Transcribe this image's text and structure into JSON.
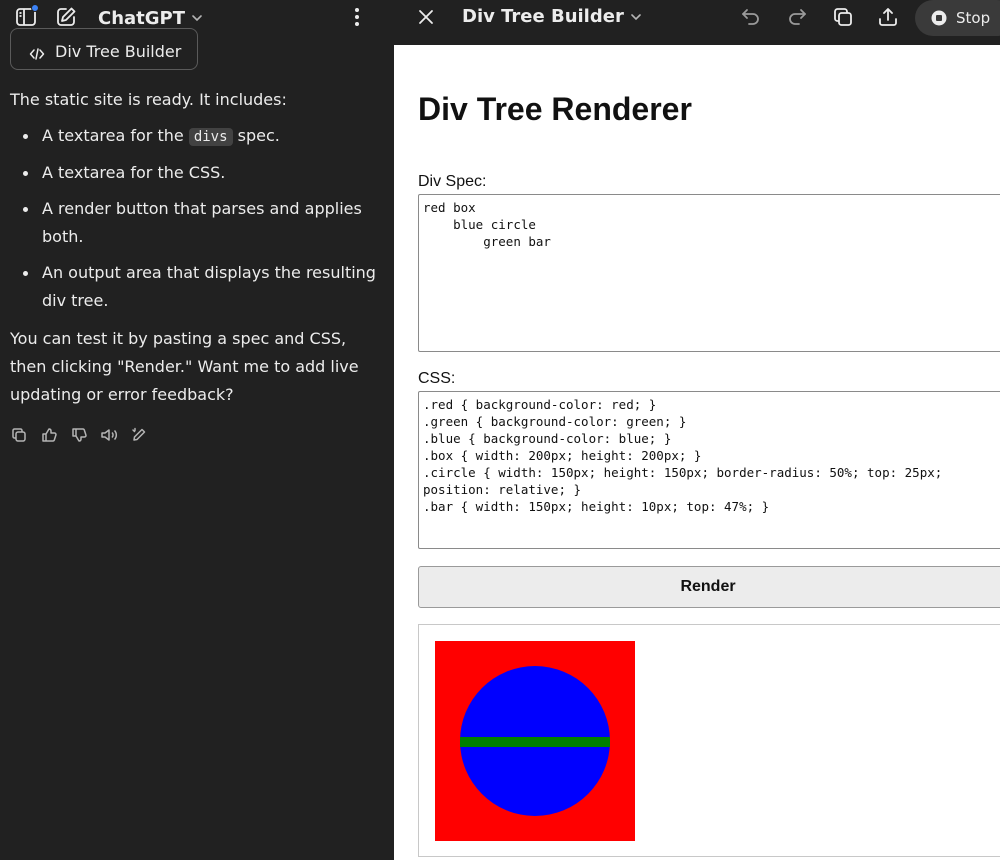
{
  "left_pane": {
    "model_name": "ChatGPT",
    "canvas_chip": {
      "label": "Div Tree Builder"
    },
    "message": {
      "intro": "The static site is ready. It includes:",
      "bullets": [
        {
          "before": "A textarea for the ",
          "code": "divs",
          "after": " spec."
        },
        {
          "before": "A textarea for the CSS.",
          "code": "",
          "after": ""
        },
        {
          "before": "A render button that parses and applies both.",
          "code": "",
          "after": ""
        },
        {
          "before": "An output area that displays the resulting div tree.",
          "code": "",
          "after": ""
        }
      ],
      "outro": "You can test it by pasting a spec and CSS, then clicking \"Render.\" Want me to add live updating or error feedback?"
    },
    "actions": [
      "copy-icon",
      "thumbs-up-icon",
      "thumbs-down-icon",
      "read-aloud-icon",
      "edit-icon"
    ]
  },
  "right_pane": {
    "doc_title": "Div Tree Builder",
    "stop_label": "Stop",
    "page": {
      "heading": "Div Tree Renderer",
      "spec_label": "Div Spec:",
      "spec_value": "red box\n    blue circle\n        green bar",
      "css_label": "CSS:",
      "css_value": ".red { background-color: red; }\n.green { background-color: green; }\n.blue { background-color: blue; }\n.box { width: 200px; height: 200px; }\n.circle { width: 150px; height: 150px; border-radius: 50%; top: 25px; position: relative; }\n.bar { width: 150px; height: 10px; top: 47%; }",
      "render_label": "Render"
    }
  },
  "colors": {
    "chat_bg": "#212121",
    "chat_text": "#ececec",
    "accent_dot": "#3b82f6",
    "render_red": "#ff0000",
    "render_blue": "#0000ff",
    "render_green": "#008000"
  }
}
